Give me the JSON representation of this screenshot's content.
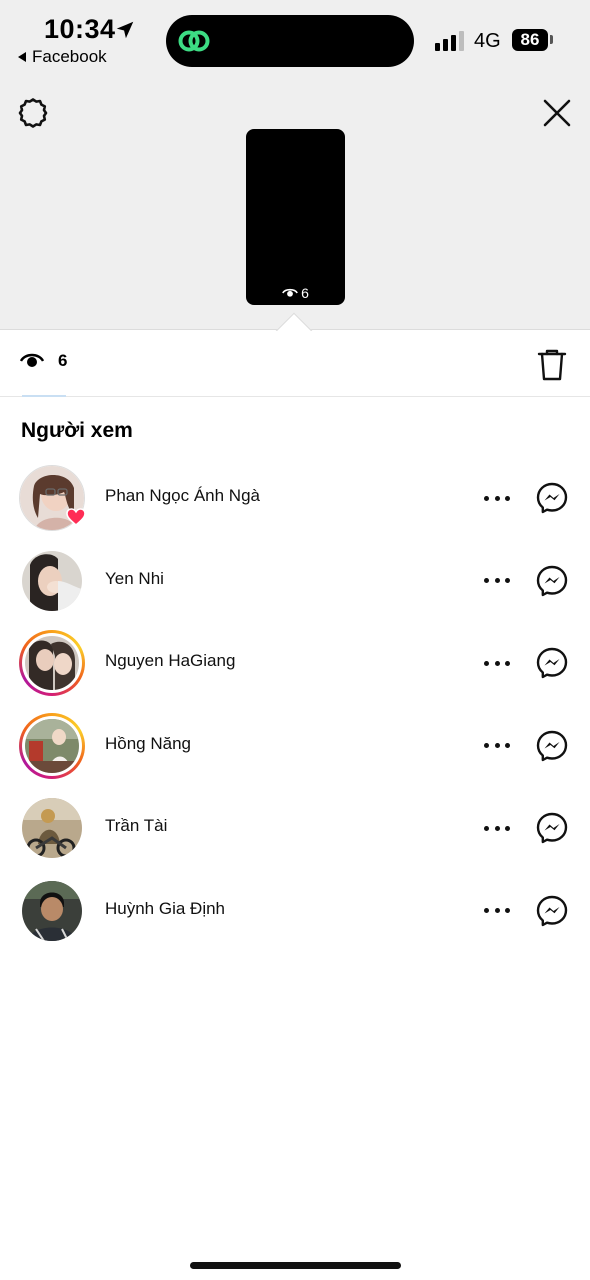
{
  "status_bar": {
    "time": "10:34",
    "back_app": "Facebook",
    "network": "4G",
    "battery": "86"
  },
  "story": {
    "thumb_view_count": "6"
  },
  "tabs": {
    "view_count": "6"
  },
  "viewers": {
    "title": "Người xem",
    "items": [
      {
        "name": "Phan Ngọc Ánh Ngà",
        "reaction": "heart-icon",
        "story_ring": false
      },
      {
        "name": "Yen Nhi",
        "reaction": "",
        "story_ring": false
      },
      {
        "name": "Nguyen HaGiang",
        "reaction": "",
        "story_ring": true
      },
      {
        "name": "Hồng Năng",
        "reaction": "",
        "story_ring": true
      },
      {
        "name": "Trần Tài",
        "reaction": "",
        "story_ring": false
      },
      {
        "name": "Huỳnh Gia Định",
        "reaction": "",
        "story_ring": false
      }
    ]
  },
  "colors": {
    "header_bg": "#efefef",
    "reaction_heart": "#ff2d55",
    "story_ring_start": "#f9a11b",
    "story_ring_end": "#b0189b",
    "island_icon": "#3ddc84"
  }
}
